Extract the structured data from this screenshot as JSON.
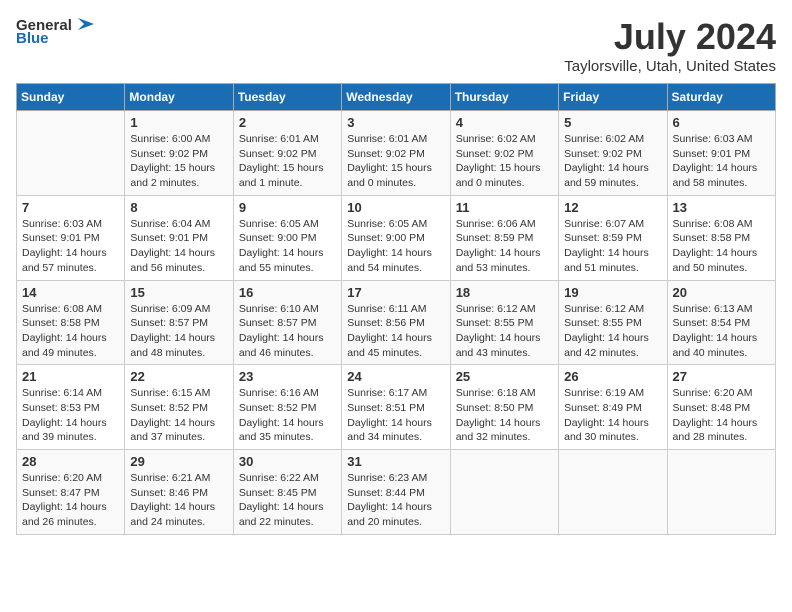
{
  "logo": {
    "general": "General",
    "blue": "Blue"
  },
  "title": "July 2024",
  "subtitle": "Taylorsville, Utah, United States",
  "days_of_week": [
    "Sunday",
    "Monday",
    "Tuesday",
    "Wednesday",
    "Thursday",
    "Friday",
    "Saturday"
  ],
  "weeks": [
    [
      {
        "day": "",
        "info": ""
      },
      {
        "day": "1",
        "info": "Sunrise: 6:00 AM\nSunset: 9:02 PM\nDaylight: 15 hours\nand 2 minutes."
      },
      {
        "day": "2",
        "info": "Sunrise: 6:01 AM\nSunset: 9:02 PM\nDaylight: 15 hours\nand 1 minute."
      },
      {
        "day": "3",
        "info": "Sunrise: 6:01 AM\nSunset: 9:02 PM\nDaylight: 15 hours\nand 0 minutes."
      },
      {
        "day": "4",
        "info": "Sunrise: 6:02 AM\nSunset: 9:02 PM\nDaylight: 15 hours\nand 0 minutes."
      },
      {
        "day": "5",
        "info": "Sunrise: 6:02 AM\nSunset: 9:02 PM\nDaylight: 14 hours\nand 59 minutes."
      },
      {
        "day": "6",
        "info": "Sunrise: 6:03 AM\nSunset: 9:01 PM\nDaylight: 14 hours\nand 58 minutes."
      }
    ],
    [
      {
        "day": "7",
        "info": "Sunrise: 6:03 AM\nSunset: 9:01 PM\nDaylight: 14 hours\nand 57 minutes."
      },
      {
        "day": "8",
        "info": "Sunrise: 6:04 AM\nSunset: 9:01 PM\nDaylight: 14 hours\nand 56 minutes."
      },
      {
        "day": "9",
        "info": "Sunrise: 6:05 AM\nSunset: 9:00 PM\nDaylight: 14 hours\nand 55 minutes."
      },
      {
        "day": "10",
        "info": "Sunrise: 6:05 AM\nSunset: 9:00 PM\nDaylight: 14 hours\nand 54 minutes."
      },
      {
        "day": "11",
        "info": "Sunrise: 6:06 AM\nSunset: 8:59 PM\nDaylight: 14 hours\nand 53 minutes."
      },
      {
        "day": "12",
        "info": "Sunrise: 6:07 AM\nSunset: 8:59 PM\nDaylight: 14 hours\nand 51 minutes."
      },
      {
        "day": "13",
        "info": "Sunrise: 6:08 AM\nSunset: 8:58 PM\nDaylight: 14 hours\nand 50 minutes."
      }
    ],
    [
      {
        "day": "14",
        "info": "Sunrise: 6:08 AM\nSunset: 8:58 PM\nDaylight: 14 hours\nand 49 minutes."
      },
      {
        "day": "15",
        "info": "Sunrise: 6:09 AM\nSunset: 8:57 PM\nDaylight: 14 hours\nand 48 minutes."
      },
      {
        "day": "16",
        "info": "Sunrise: 6:10 AM\nSunset: 8:57 PM\nDaylight: 14 hours\nand 46 minutes."
      },
      {
        "day": "17",
        "info": "Sunrise: 6:11 AM\nSunset: 8:56 PM\nDaylight: 14 hours\nand 45 minutes."
      },
      {
        "day": "18",
        "info": "Sunrise: 6:12 AM\nSunset: 8:55 PM\nDaylight: 14 hours\nand 43 minutes."
      },
      {
        "day": "19",
        "info": "Sunrise: 6:12 AM\nSunset: 8:55 PM\nDaylight: 14 hours\nand 42 minutes."
      },
      {
        "day": "20",
        "info": "Sunrise: 6:13 AM\nSunset: 8:54 PM\nDaylight: 14 hours\nand 40 minutes."
      }
    ],
    [
      {
        "day": "21",
        "info": "Sunrise: 6:14 AM\nSunset: 8:53 PM\nDaylight: 14 hours\nand 39 minutes."
      },
      {
        "day": "22",
        "info": "Sunrise: 6:15 AM\nSunset: 8:52 PM\nDaylight: 14 hours\nand 37 minutes."
      },
      {
        "day": "23",
        "info": "Sunrise: 6:16 AM\nSunset: 8:52 PM\nDaylight: 14 hours\nand 35 minutes."
      },
      {
        "day": "24",
        "info": "Sunrise: 6:17 AM\nSunset: 8:51 PM\nDaylight: 14 hours\nand 34 minutes."
      },
      {
        "day": "25",
        "info": "Sunrise: 6:18 AM\nSunset: 8:50 PM\nDaylight: 14 hours\nand 32 minutes."
      },
      {
        "day": "26",
        "info": "Sunrise: 6:19 AM\nSunset: 8:49 PM\nDaylight: 14 hours\nand 30 minutes."
      },
      {
        "day": "27",
        "info": "Sunrise: 6:20 AM\nSunset: 8:48 PM\nDaylight: 14 hours\nand 28 minutes."
      }
    ],
    [
      {
        "day": "28",
        "info": "Sunrise: 6:20 AM\nSunset: 8:47 PM\nDaylight: 14 hours\nand 26 minutes."
      },
      {
        "day": "29",
        "info": "Sunrise: 6:21 AM\nSunset: 8:46 PM\nDaylight: 14 hours\nand 24 minutes."
      },
      {
        "day": "30",
        "info": "Sunrise: 6:22 AM\nSunset: 8:45 PM\nDaylight: 14 hours\nand 22 minutes."
      },
      {
        "day": "31",
        "info": "Sunrise: 6:23 AM\nSunset: 8:44 PM\nDaylight: 14 hours\nand 20 minutes."
      },
      {
        "day": "",
        "info": ""
      },
      {
        "day": "",
        "info": ""
      },
      {
        "day": "",
        "info": ""
      }
    ]
  ]
}
